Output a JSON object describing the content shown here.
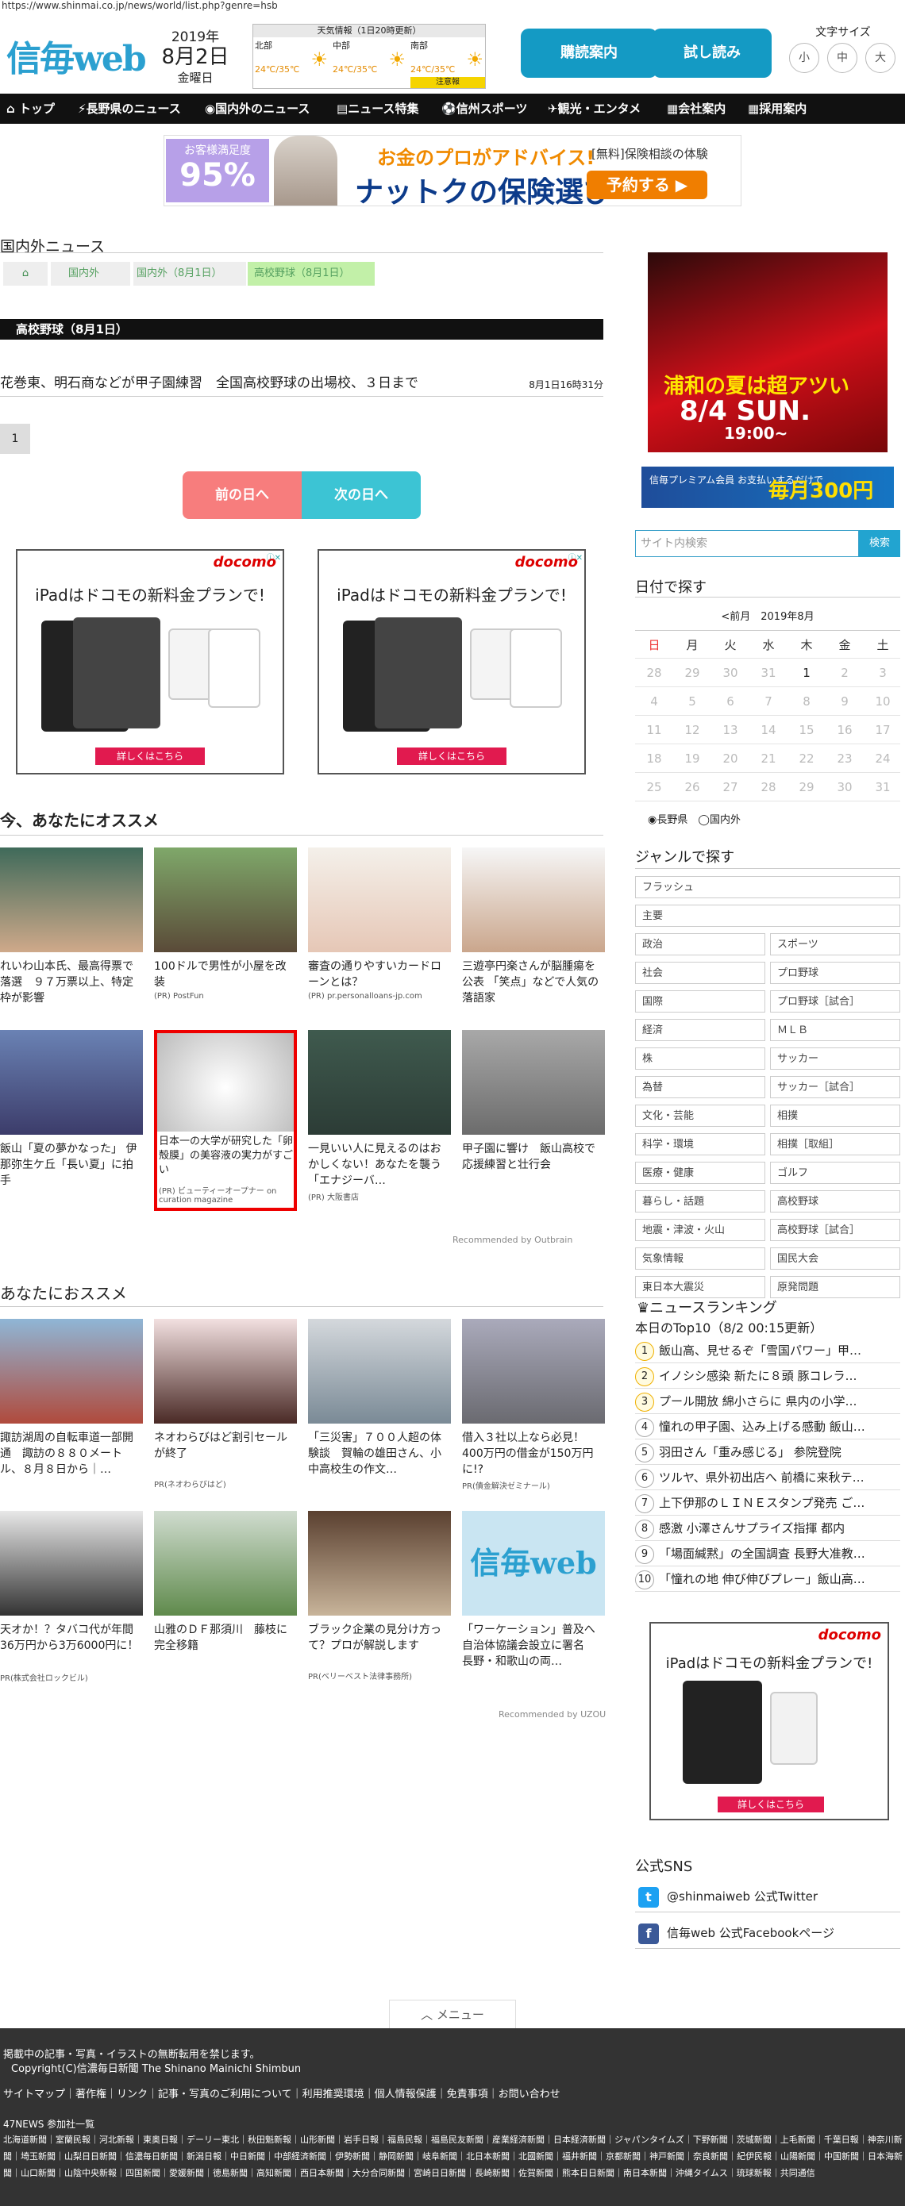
{
  "url": "https://www.shinmai.co.jp/news/world/list.php?genre=hsb",
  "logo": "信毎web",
  "date": {
    "year": "2019年",
    "md": "8月2日",
    "weekday": "金曜日"
  },
  "weather": {
    "title": "天気情報（1日20時更新）",
    "regions": [
      {
        "name": "北部",
        "temp": "24℃/35℃"
      },
      {
        "name": "中部",
        "temp": "24℃/35℃"
      },
      {
        "name": "南部",
        "temp": "24℃/35℃"
      }
    ],
    "warn": "注意報"
  },
  "buttons": {
    "subscribe": "購読案内",
    "trial": "試し読み"
  },
  "fontsize": {
    "label": "文字サイズ",
    "small": "小",
    "mid": "中",
    "large": "大"
  },
  "nav": [
    "トップ",
    "長野県のニュース",
    "国内外のニュース",
    "ニュース特集",
    "信州スポーツ",
    "観光・エンタメ",
    "会社案内",
    "採用案内"
  ],
  "banner": {
    "sat_label": "お客様満足度",
    "sat_value": "95%",
    "t1": "お金のプロがアドバイス!",
    "t2": "ナットクの保険選び",
    "t3": "[無料]保険相談の体験",
    "btn": "予約する ▶"
  },
  "section_title": "国内外ニュース",
  "breadcrumb": [
    "国内外",
    "国内外（8月1日）",
    "高校野球（8月1日）"
  ],
  "category": "高校野球（8月1日）",
  "news": [
    {
      "title": "花巻東、明石商などが甲子園練習　全国高校野球の出場校、３日まで",
      "time": "8月1日16時31分"
    }
  ],
  "page": "1",
  "prev": "前の日へ",
  "next": "次の日へ",
  "ads": {
    "docomo": "docomo",
    "title": "iPadはドコモの新料金プランで!",
    "cta": "詳しくはこちら"
  },
  "reco1": {
    "title": "今、あなたにオススメ",
    "items": [
      {
        "text": "れいわ山本氏、最高得票で落選　９７万票以上、特定枠が影響",
        "pr": ""
      },
      {
        "text": "100ドルで男性が小屋を改装",
        "pr": "(PR) PostFun"
      },
      {
        "text": "審査の通りやすいカードローンとは？",
        "pr": "(PR) pr.personalloans-jp.com"
      },
      {
        "text": "三遊亭円楽さんが脳腫瘍を公表 「笑点」などで人気の落語家",
        "pr": ""
      },
      {
        "text": "飯山「夏の夢かなった」 伊那弥生ケ丘「長い夏」に拍手",
        "pr": ""
      },
      {
        "text": "日本一の大学が研究した「卵殻膜」の美容液の実力がすごい",
        "pr": "(PR) ビューティーオープナー on curation magazine"
      },
      {
        "text": "一見いい人に見えるのはおかしくない！あなたを襲う「エナジーバ…",
        "pr": "(PR) 大阪書店"
      },
      {
        "text": "甲子園に響け　飯山高校で応援練習と壮行会",
        "pr": ""
      }
    ],
    "recommended": "Recommended by Outbrain"
  },
  "reco2": {
    "title": "あなたにおススメ",
    "items": [
      {
        "text": "諏訪湖周の自転車道一部開通　諏訪の８８０メートル、８月８日から｜…",
        "pr": ""
      },
      {
        "text": "ネオわらびはど割引セールが終了",
        "pr": "PR(ネオわらびはど)"
      },
      {
        "text": "「三災害」７００人超の体験談　賀輪の雄田さん、小中高校生の作文…",
        "pr": ""
      },
      {
        "text": "借入３社以上なら必見！400万円の借金が150万円に!?",
        "pr": "PR(債金解決ゼミナール)"
      },
      {
        "text": "天オか！？タバコ代が年間36万円から3万6000円に！",
        "pr": "PR(株式会社ロックビル)"
      },
      {
        "text": "山雅のＤＦ那須川　藤枝に完全移籍",
        "pr": ""
      },
      {
        "text": "ブラック企業の見分け方って？プロが解説します",
        "pr": "PR(ベリーベスト法律事務所)"
      },
      {
        "text": "「ワーケーション」普及へ自治体協議会設立に署名　長野・和歌山の両…",
        "pr": ""
      }
    ],
    "recommended": "Recommended by UZOU"
  },
  "side": {
    "ad1_t1": "浦和の夏は超アツい",
    "ad1_t2": "8/4 SUN.",
    "ad1_t3": "19:00~",
    "ad2_a": "信毎プレミアム会員 お支払いするだけで",
    "ad2_b": "毎月300円",
    "search_ph": "サイト内検索",
    "search_btn": "検索",
    "cal_title": "日付で探す",
    "cal_nav": "<前月　2019年8月",
    "weekdays": [
      "日",
      "月",
      "火",
      "水",
      "木",
      "金",
      "土"
    ],
    "radio": [
      "長野県",
      "国内外"
    ],
    "genre_title": "ジャンルで探す",
    "genres_full": [
      "フラッシュ",
      "主要"
    ],
    "genres": [
      "政治",
      "スポーツ",
      "社会",
      "プロ野球",
      "国際",
      "プロ野球［試合］",
      "経済",
      "ＭＬＢ",
      "株",
      "サッカー",
      "為替",
      "サッカー［試合］",
      "文化・芸能",
      "相撲",
      "科学・環境",
      "相撲［取組］",
      "医療・健康",
      "ゴルフ",
      "暮らし・話題",
      "高校野球",
      "地震・津波・火山",
      "高校野球［試合］",
      "気象情報",
      "国民大会",
      "東日本大震災",
      "原発問題"
    ],
    "ranking_title": "ニュースランキング",
    "ranking_sub": "本日のTop10（8/2 00:15更新）",
    "ranking": [
      "飯山高、見せるぞ「雪国パワー」甲…",
      "イノシシ感染 新たに８頭 豚コレラ…",
      "プール開放 綿小さらに 県内の小学…",
      "憧れの甲子園、込み上げる感動 飯山…",
      "羽田さん「重み感じる」 参院登院",
      "ツルヤ、県外初出店へ 前橋に来秋テ…",
      "上下伊那のＬＩＮＥスタンプ発売 ご…",
      "感激 小澤さんサプライズ指揮 都内",
      "「場面緘黙」の全国調査 長野大准教…",
      "「憧れの地 伸び伸びプレー」飯山高…"
    ],
    "sns_title": "公式SNS",
    "twitter": "@shinmaiweb 公式Twitter",
    "facebook": "信毎web 公式Facebookページ"
  },
  "menu": "メニュー",
  "footer": {
    "notice": "掲載中の記事・写真・イラストの無断転用を禁じます。",
    "copyright": "Copyright(C)信濃毎日新聞 The Shinano Mainichi Shimbun",
    "links": "サイトマップ｜著作権｜リンク｜記事・写真のご利用について｜利用推奨環境｜個人情報保護｜免責事項｜お問い合わせ",
    "news47": "47NEWS 参加社一覧",
    "papers": "北海道新聞｜室蘭民報｜河北新報｜東奥日報｜デーリー東北｜秋田魁新報｜山形新聞｜岩手日報｜福島民報｜福島民友新聞｜産業経済新聞｜日本経済新聞｜ジャパンタイムズ｜下野新聞｜茨城新聞｜上毛新聞｜千葉日報｜神奈川新聞｜埼玉新聞｜山梨日日新聞｜信濃毎日新聞｜新潟日報｜中日新聞｜中部経済新聞｜伊勢新聞｜静岡新聞｜岐阜新聞｜北日本新聞｜北國新聞｜福井新聞｜京都新聞｜神戸新聞｜奈良新聞｜紀伊民報｜山陽新聞｜中国新聞｜日本海新聞｜山口新聞｜山陰中央新報｜四国新聞｜愛媛新聞｜徳島新聞｜高知新聞｜西日本新聞｜大分合同新聞｜宮崎日日新聞｜長崎新聞｜佐賀新聞｜熊本日日新聞｜南日本新聞｜沖縄タイムス｜琉球新報｜共同通信"
  }
}
